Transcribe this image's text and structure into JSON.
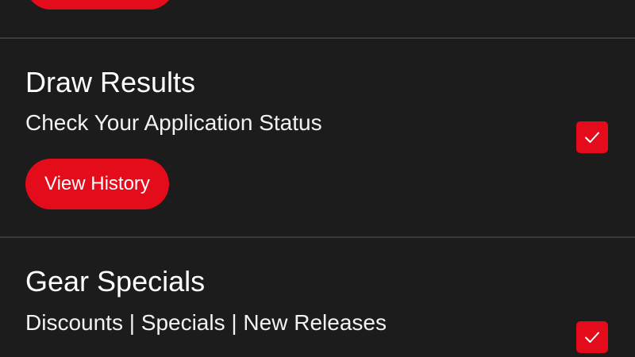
{
  "sections": [
    {
      "title": "Draw Results",
      "subtitle": "Check Your Application Status",
      "button_label": "View History",
      "checked": true
    },
    {
      "title": "Gear Specials",
      "subtitle": "Discounts | Specials | New Releases",
      "checked": true
    }
  ],
  "colors": {
    "background": "#1c1c1d",
    "accent": "#e40b1b",
    "divider": "#3b3b3d",
    "text": "#ffffff"
  },
  "icons": {
    "checkbox_mark": "checkmark-icon"
  }
}
